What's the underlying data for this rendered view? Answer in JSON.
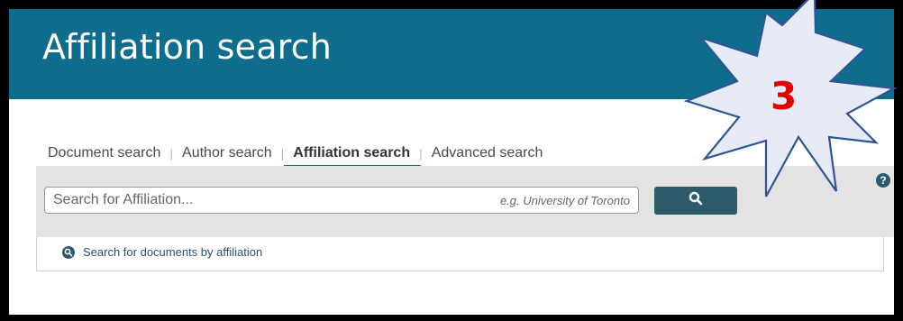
{
  "header": {
    "title": "Affiliation search"
  },
  "tabs": [
    {
      "label": "Document search",
      "active": false
    },
    {
      "label": "Author search",
      "active": false
    },
    {
      "label": "Affiliation search",
      "active": true
    },
    {
      "label": "Advanced search",
      "active": false
    }
  ],
  "tab_separator": "|",
  "search": {
    "placeholder": "Search for Affiliation...",
    "example": "e.g. University of Toronto",
    "button_icon": "search-icon"
  },
  "help": {
    "label": "?"
  },
  "links": {
    "search_docs_by_affiliation": "Search for documents by affiliation"
  },
  "annotation": {
    "number": "3"
  },
  "colors": {
    "header_bg": "#0e6c8d",
    "button_bg": "#2d5b6b",
    "panel_bg": "#e3e3e3",
    "starburst_fill": "#e6ebf5",
    "starburst_stroke": "#2f5597",
    "annotation_text": "#e00000"
  }
}
